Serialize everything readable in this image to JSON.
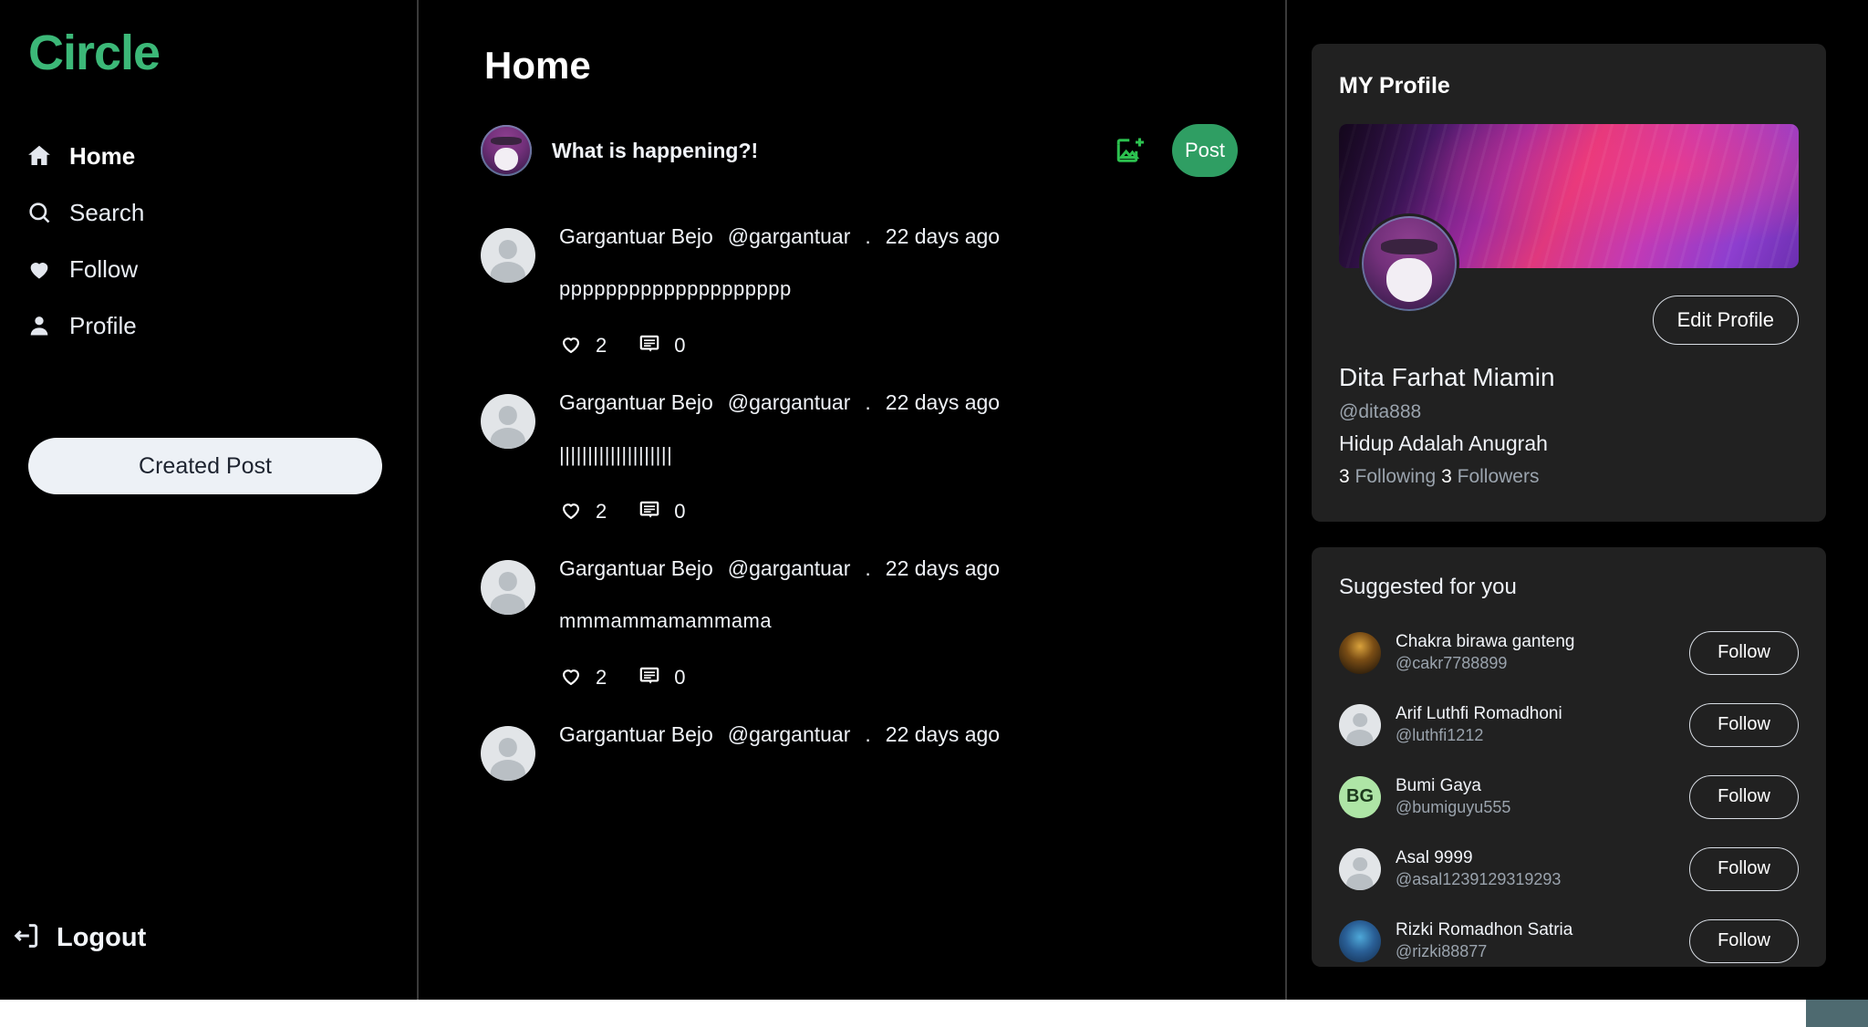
{
  "brand": {
    "name": "Circle",
    "color": "#3cb878"
  },
  "sidebar": {
    "items": [
      {
        "label": "Home",
        "icon": "home-icon"
      },
      {
        "label": "Search",
        "icon": "search-icon"
      },
      {
        "label": "Follow",
        "icon": "heart-icon"
      },
      {
        "label": "Profile",
        "icon": "person-icon"
      }
    ],
    "created_post_label": "Created Post",
    "logout_label": "Logout"
  },
  "main": {
    "title": "Home",
    "composer": {
      "placeholder": "What is happening?!",
      "image_icon": "add-image-icon",
      "post_label": "Post"
    },
    "posts": [
      {
        "name": "Gargantuar Bejo",
        "handle": "@gargantuar",
        "separator": ".",
        "time": "22 days ago",
        "text": "pppppppppppppppppppp",
        "likes": "2",
        "comments": "0"
      },
      {
        "name": "Gargantuar Bejo",
        "handle": "@gargantuar",
        "separator": ".",
        "time": "22 days ago",
        "text": "||||||||||||||||||||",
        "likes": "2",
        "comments": "0"
      },
      {
        "name": "Gargantuar Bejo",
        "handle": "@gargantuar",
        "separator": ".",
        "time": "22 days ago",
        "text": "mmmammamammama",
        "likes": "2",
        "comments": "0"
      },
      {
        "name": "Gargantuar Bejo",
        "handle": "@gargantuar",
        "separator": ".",
        "time": "22 days ago",
        "text": "",
        "likes": "",
        "comments": ""
      }
    ]
  },
  "rail": {
    "profile": {
      "card_title": "MY Profile",
      "edit_label": "Edit Profile",
      "fullname": "Dita Farhat Miamin",
      "username": "@dita888",
      "bio": "Hidup Adalah Anugrah",
      "following_count": "3",
      "following_label": "Following",
      "followers_count": "3",
      "followers_label": "Followers"
    },
    "suggested": {
      "title": "Suggested for you",
      "follow_label": "Follow",
      "users": [
        {
          "name": "Chakra birawa ganteng",
          "handle": "@cakr7788899",
          "avatar": "knight",
          "initials": ""
        },
        {
          "name": "Arif Luthfi Romadhoni",
          "handle": "@luthfi1212",
          "avatar": "placeholder",
          "initials": ""
        },
        {
          "name": "Bumi Gaya",
          "handle": "@bumiguyu555",
          "avatar": "initials",
          "initials": "BG"
        },
        {
          "name": "Asal 9999",
          "handle": "@asal1239129319293",
          "avatar": "placeholder",
          "initials": ""
        },
        {
          "name": "Rizki Romadhon Satria",
          "handle": "@rizki88877",
          "avatar": "blue",
          "initials": ""
        }
      ]
    }
  }
}
